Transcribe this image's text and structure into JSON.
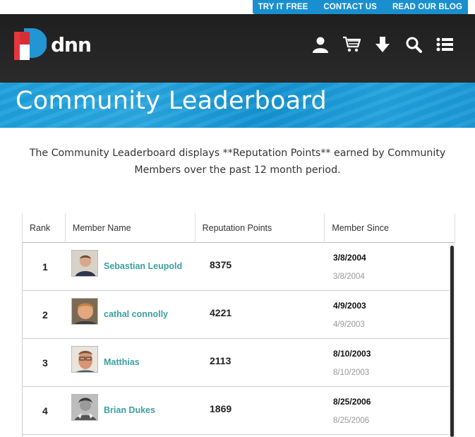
{
  "util_nav": {
    "links": [
      "TRY IT FREE",
      "CONTACT US",
      "READ OUR BLOG"
    ]
  },
  "header": {
    "logo_text": "dnn",
    "icons": [
      "user-icon",
      "cart-icon",
      "download-icon",
      "search-icon",
      "list-menu-icon"
    ]
  },
  "banner": {
    "title": "Community Leaderboard"
  },
  "intro": {
    "text": "The Community Leaderboard displays **Reputation Points** earned by Community Members over the past 12 month period."
  },
  "table": {
    "columns": [
      "Rank",
      "Member Name",
      "Reputation Points",
      "Member Since"
    ],
    "rows": [
      {
        "rank": "1",
        "name": "Sebastian Leupold",
        "points": "8375",
        "since": "3/8/2004",
        "since_sub": "3/8/2004"
      },
      {
        "rank": "2",
        "name": "cathal connolly",
        "points": "4221",
        "since": "4/9/2003",
        "since_sub": "4/9/2003"
      },
      {
        "rank": "3",
        "name": "Matthias",
        "points": "2113",
        "since": "8/10/2003",
        "since_sub": "8/10/2003"
      },
      {
        "rank": "4",
        "name": "Brian Dukes",
        "points": "1869",
        "since": "8/25/2006",
        "since_sub": "8/25/2006"
      }
    ]
  },
  "colors": {
    "accent_blue": "#1a8fcf",
    "header_dark": "#222222",
    "link_teal": "#3a9fa0",
    "logo_red": "#e8363d",
    "logo_blue": "#2196d3"
  }
}
